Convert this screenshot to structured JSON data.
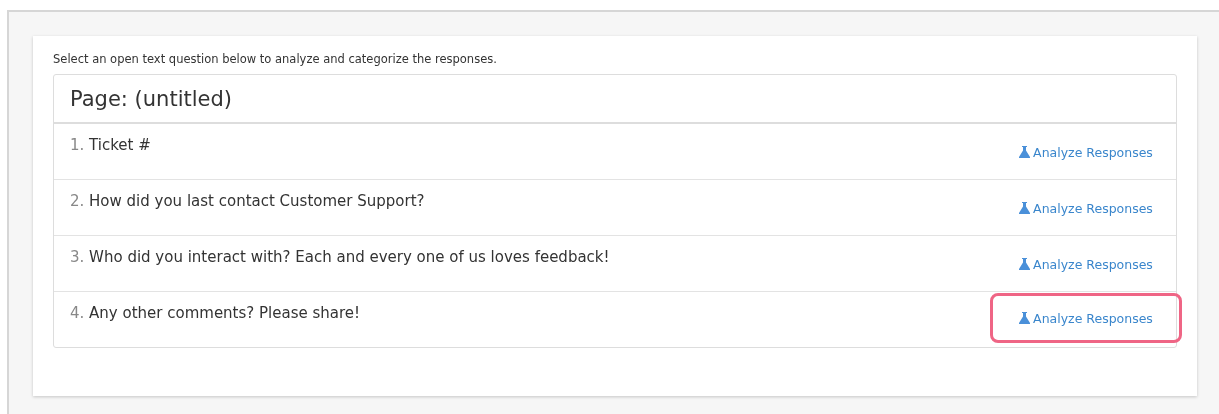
{
  "intro": "Select an open text question below to analyze and categorize the responses.",
  "page_title": "Page: (untitled)",
  "questions": [
    {
      "number": "1.",
      "text": "Ticket #",
      "action": "Analyze Responses",
      "highlighted": false
    },
    {
      "number": "2.",
      "text": "How did you last contact Customer Support?",
      "action": "Analyze Responses",
      "highlighted": false
    },
    {
      "number": "3.",
      "text": "Who did you interact with? Each and every one of us loves feedback!",
      "action": "Analyze Responses",
      "highlighted": false
    },
    {
      "number": "4.",
      "text": "Any other comments? Please share!",
      "action": "Analyze Responses",
      "highlighted": true
    }
  ]
}
